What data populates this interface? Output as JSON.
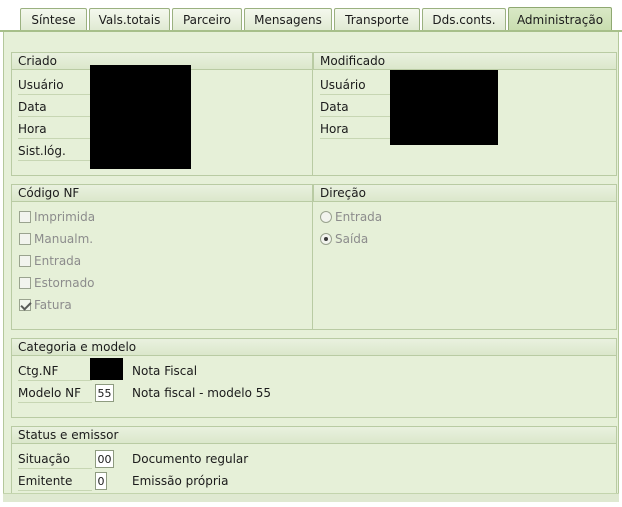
{
  "tabs": [
    {
      "label": "Síntese",
      "active": false
    },
    {
      "label": "Vals.totais",
      "active": false
    },
    {
      "label": "Parceiro",
      "active": false
    },
    {
      "label": "Mensagens",
      "active": false
    },
    {
      "label": "Transporte",
      "active": false
    },
    {
      "label": "Dds.conts.",
      "active": false
    },
    {
      "label": "Administração",
      "active": true
    }
  ],
  "criado": {
    "title": "Criado",
    "usuario_label": "Usuário",
    "data_label": "Data",
    "hora_label": "Hora",
    "sistlog_label": "Sist.lóg."
  },
  "modificado": {
    "title": "Modificado",
    "usuario_label": "Usuário",
    "data_label": "Data",
    "hora_label": "Hora"
  },
  "codigo_nf": {
    "title": "Código NF",
    "options": [
      {
        "label": "Imprimida",
        "checked": false
      },
      {
        "label": "Manualm.",
        "checked": false
      },
      {
        "label": "Entrada",
        "checked": false
      },
      {
        "label": "Estornado",
        "checked": false
      },
      {
        "label": "Fatura",
        "checked": true
      }
    ]
  },
  "direcao": {
    "title": "Direção",
    "options": [
      {
        "label": "Entrada",
        "selected": false
      },
      {
        "label": "Saída",
        "selected": true
      }
    ]
  },
  "categoria": {
    "title": "Categoria e modelo",
    "ctg_label": "Ctg.NF",
    "ctg_desc": "Nota Fiscal",
    "modelo_label": "Modelo NF",
    "modelo_value": "55",
    "modelo_desc": "Nota fiscal - modelo 55"
  },
  "status": {
    "title": "Status e emissor",
    "situacao_label": "Situação",
    "situacao_value": "00",
    "situacao_desc": "Documento regular",
    "emitente_label": "Emitente",
    "emitente_value": "0",
    "emitente_desc": "Emissão própria"
  },
  "colors": {
    "panel_bg": "#e6f0d8",
    "border": "#b9cba3",
    "active_tab": "#c7dcad"
  }
}
